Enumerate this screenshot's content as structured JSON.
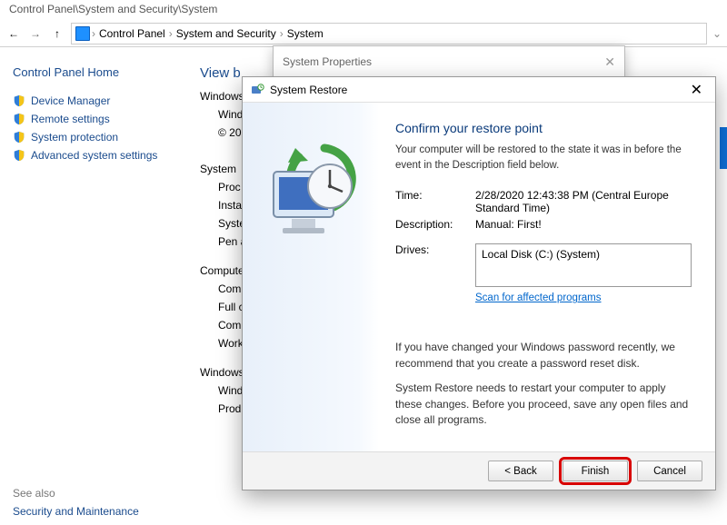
{
  "window": {
    "title": "Control Panel\\System and Security\\System"
  },
  "breadcrumb": {
    "root": "Control Panel",
    "mid": "System and Security",
    "leaf": "System"
  },
  "sidebar": {
    "home": "Control Panel Home",
    "items": [
      {
        "label": "Device Manager"
      },
      {
        "label": "Remote settings"
      },
      {
        "label": "System protection"
      },
      {
        "label": "Advanced system settings"
      }
    ],
    "see_also": "See also",
    "sec_link": "Security and Maintenance"
  },
  "content": {
    "heading_partial": "View b",
    "section1": "Windows",
    "section1_items": [
      "Wind",
      "© 20"
    ],
    "section2": "System",
    "section2_items": [
      "Proc",
      "Insta",
      "Syste",
      "Pen a"
    ],
    "section3": "Compute",
    "section3_items": [
      "Com",
      "Full c",
      "Com",
      "Work"
    ],
    "section4": "Windows",
    "section4_items": [
      "Wind",
      "Prod"
    ]
  },
  "sysprops": {
    "title": "System Properties"
  },
  "restore": {
    "title": "System Restore",
    "heading": "Confirm your restore point",
    "explain": "Your computer will be restored to the state it was in before the event in the Description field below.",
    "time_label": "Time:",
    "time_value": "2/28/2020 12:43:38 PM (Central Europe Standard Time)",
    "desc_label": "Description:",
    "desc_value": "Manual: First!",
    "drives_label": "Drives:",
    "drives_value": "Local Disk (C:) (System)",
    "scan_link": "Scan for affected programs",
    "pw_note": "If you have changed your Windows password recently, we recommend that you create a password reset disk.",
    "restart_note": "System Restore needs to restart your computer to apply these changes. Before you proceed, save any open files and close all programs.",
    "back": "< Back",
    "finish": "Finish",
    "cancel": "Cancel"
  }
}
